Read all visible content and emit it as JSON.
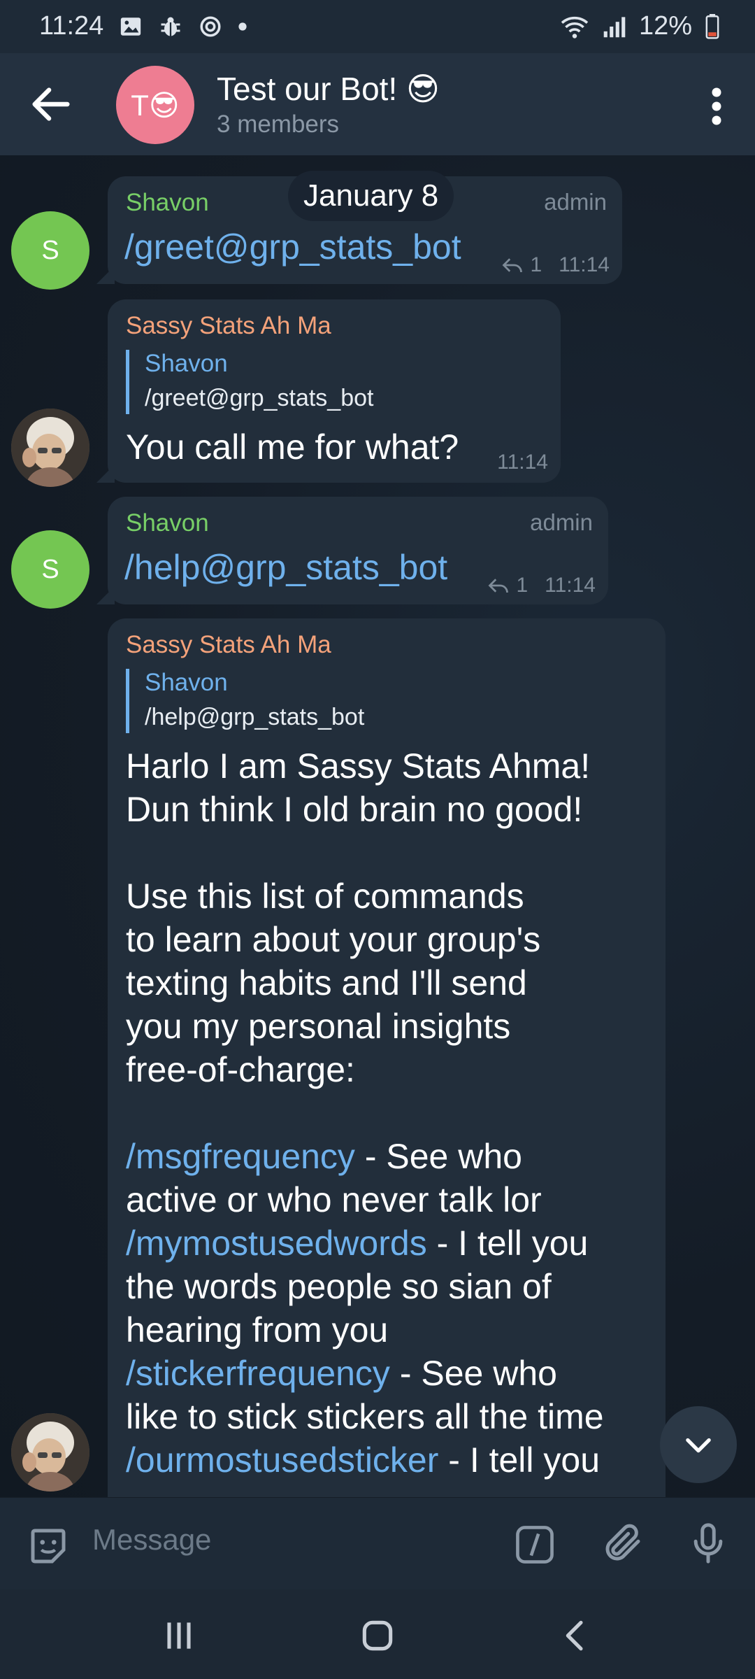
{
  "status_bar": {
    "time": "11:24",
    "battery": "12%",
    "icons": [
      "gallery-icon",
      "bug-icon",
      "sync-icon",
      "dot-icon",
      "wifi-icon",
      "signal-icon",
      "battery-icon"
    ]
  },
  "header": {
    "title": "Test our Bot! 😎",
    "subtitle": "3 members",
    "avatar_letter": "T😎",
    "avatar_color": "#ee7d92"
  },
  "date_divider": "January 8",
  "messages": [
    {
      "sender": "Shavon",
      "role": "admin",
      "text": "/greet@grp_stats_bot",
      "replies": "1",
      "time": "11:14",
      "avatar": "S"
    },
    {
      "sender": "Sassy Stats Ah Ma",
      "reply_to_name": "Shavon",
      "reply_to_text": "/greet@grp_stats_bot",
      "text": "You call me for what?",
      "time": "11:14"
    },
    {
      "sender": "Shavon",
      "role": "admin",
      "text": "/help@grp_stats_bot",
      "replies": "1",
      "time": "11:14",
      "avatar": "S"
    },
    {
      "sender": "Sassy Stats Ah Ma",
      "reply_to_name": "Shavon",
      "reply_to_text": "/help@grp_stats_bot",
      "lines": {
        "l1": "Harlo I am Sassy Stats Ahma!",
        "l2": "Dun think I old brain no good!",
        "l3": "Use this list of commands",
        "l4": "to learn about your group's",
        "l5": "texting habits and I'll send",
        "l6": "you my personal insights",
        "l7": "free-of-charge:",
        "c1": "/msgfrequency",
        "c1_desc": " - See who",
        "l8": "active or who never talk lor",
        "c2": "/mymostusedwords",
        "c2_desc": " - I tell you",
        "l9": "the words people so sian of",
        "l10": "hearing from you",
        "c3": "/stickerfrequency",
        "c3_desc": " - See who",
        "l11": "like to stick stickers all the time",
        "c4": "/ourmostusedsticker",
        "c4_desc": " - I tell you"
      }
    }
  ],
  "input": {
    "placeholder": "Message"
  },
  "colors": {
    "accent": "#6fb1ec",
    "green_sender": "#78cf67",
    "orange_sender": "#f4a27a",
    "bubble": "#222e3b"
  }
}
